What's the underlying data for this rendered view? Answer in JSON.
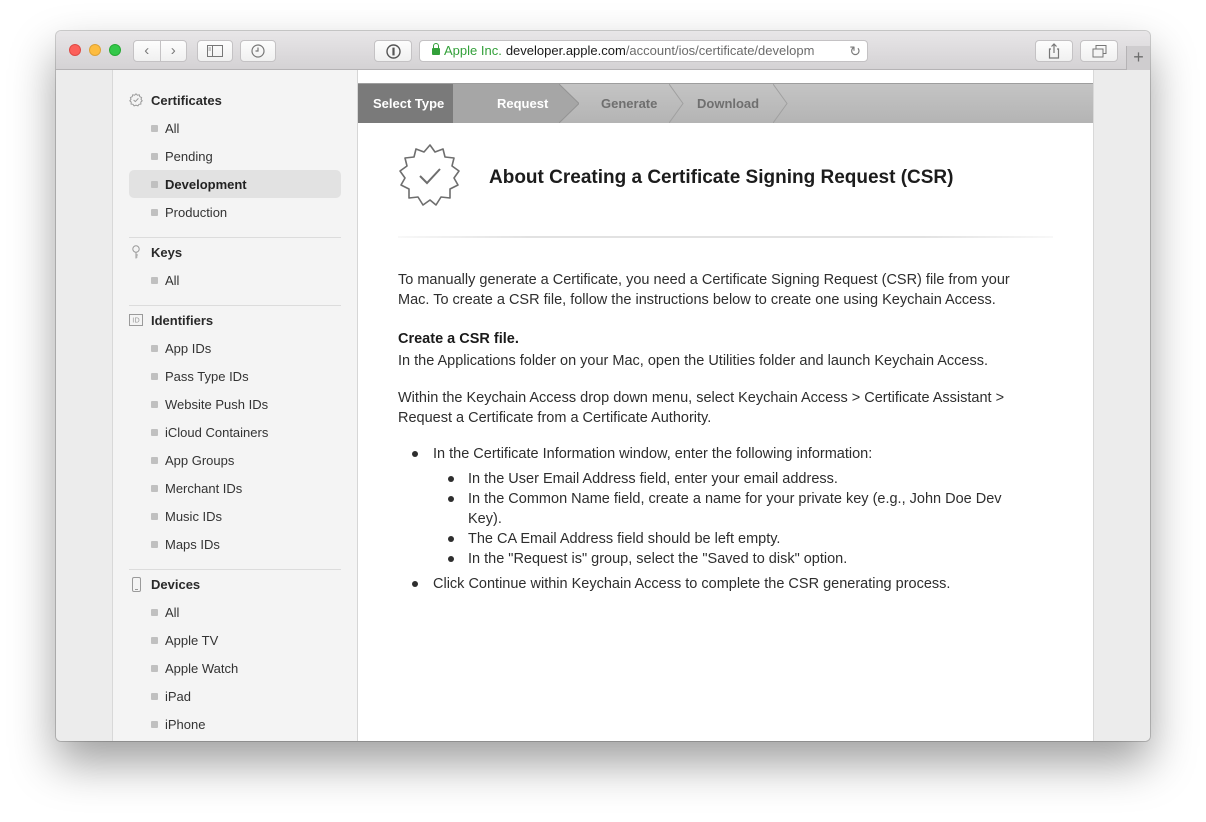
{
  "browser": {
    "url_org": "Apple Inc.",
    "url_host": "developer.apple.com",
    "url_path": "/account/ios/certificate/developm",
    "new_tab": "+"
  },
  "sidebar": {
    "certificates": {
      "title": "Certificates",
      "icon": "certificate-badge-icon",
      "items": [
        "All",
        "Pending",
        "Development",
        "Production"
      ],
      "selected": "Development"
    },
    "keys": {
      "title": "Keys",
      "icon": "key-icon",
      "items": [
        "All"
      ]
    },
    "identifiers": {
      "title": "Identifiers",
      "icon": "id-icon",
      "icon_text": "ID",
      "items": [
        "App IDs",
        "Pass Type IDs",
        "Website Push IDs",
        "iCloud Containers",
        "App Groups",
        "Merchant IDs",
        "Music IDs",
        "Maps IDs"
      ]
    },
    "devices": {
      "title": "Devices",
      "icon": "device-icon",
      "items": [
        "All",
        "Apple TV",
        "Apple Watch",
        "iPad",
        "iPhone"
      ]
    }
  },
  "steps": [
    "Select Type",
    "Request",
    "Generate",
    "Download"
  ],
  "main": {
    "title": "About Creating a Certificate Signing Request (CSR)",
    "intro_line1": "To manually generate a Certificate, you need a Certificate Signing Request (CSR) file from your",
    "intro_line2": "Mac. To create a CSR file, follow the instructions below to create one using Keychain Access.",
    "csr_heading": "Create a CSR file.",
    "apps_text": "In the Applications folder on your Mac, open the Utilities folder and launch Keychain Access.",
    "within_line1": "Within the Keychain Access drop down menu, select Keychain Access > Certificate Assistant >",
    "within_line2": "Request a Certificate from a Certificate Authority.",
    "bullet1": "In the Certificate Information window, enter the following information:",
    "sub1": "In the User Email Address field, enter your email address.",
    "sub2_line1": "In the Common Name field, create a name for your private key (e.g., John Doe Dev",
    "sub2_line2": "Key).",
    "sub3": "The CA Email Address field should be left empty.",
    "sub4": "In the \"Request is\" group, select the \"Saved to disk\" option.",
    "bullet2": "Click Continue within Keychain Access to complete the CSR generating process."
  },
  "colors": {
    "lock_green": "#33a03a",
    "step_active": "#7a7a7a",
    "step_current": "#a6a6a6"
  }
}
